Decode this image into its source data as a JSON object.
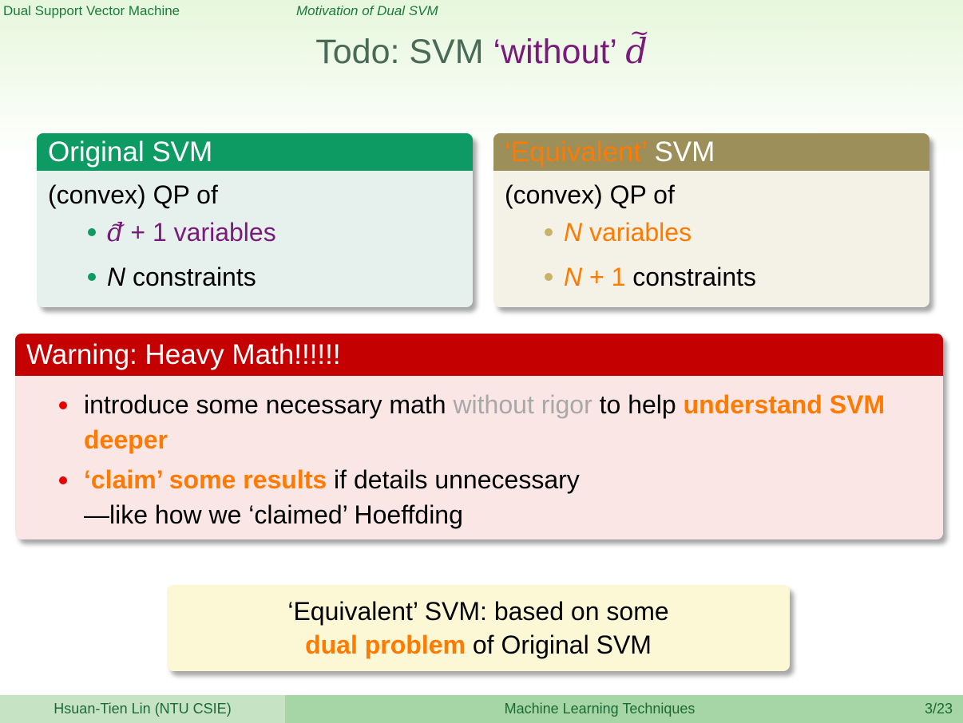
{
  "header": {
    "section": "Dual Support Vector Machine",
    "subsection": "Motivation of Dual SVM"
  },
  "title": {
    "prefix": "Todo: SVM",
    "quoted": "‘without’",
    "var": "d",
    "tilde": "~"
  },
  "original_block": {
    "title": "Original SVM",
    "intro": "(convex) QP of",
    "item1_var": "d",
    "item1_tilde": "~",
    "item1_rest": "+ 1 variables",
    "item2_var": "N",
    "item2_rest": "constraints"
  },
  "equivalent_block": {
    "title_quoted": "‘Equivalent’",
    "title_rest": "SVM",
    "intro": "(convex) QP of",
    "item1_var": "N",
    "item1_rest": "variables",
    "item2_var": "N",
    "item2_plus": "+ 1",
    "item2_rest": "constraints"
  },
  "warning_block": {
    "title": "Warning: Heavy Math!!!!!!",
    "b1_a": "introduce some necessary math",
    "b1_grey": "without rigor",
    "b1_b": "to help",
    "b1_bold": "understand SVM deeper",
    "b2_bold": "‘claim’ some results",
    "b2_a": "if details unnecessary",
    "b2_line2": "—like how we ‘claimed’ Hoeffding"
  },
  "note": {
    "line1": "‘Equivalent’ SVM: based on some",
    "bold": "dual problem",
    "line2_rest": "of Original SVM"
  },
  "footer": {
    "author": "Hsuan-Tien Lin  (NTU CSIE)",
    "course": "Machine Learning Techniques",
    "page": "3/23"
  },
  "colors": {
    "green_header": "#0e9a63",
    "olive_header": "#9c8f5a",
    "warning_header": "#c40000",
    "orange": "#ff7a00",
    "purple": "#7a1a7a"
  }
}
